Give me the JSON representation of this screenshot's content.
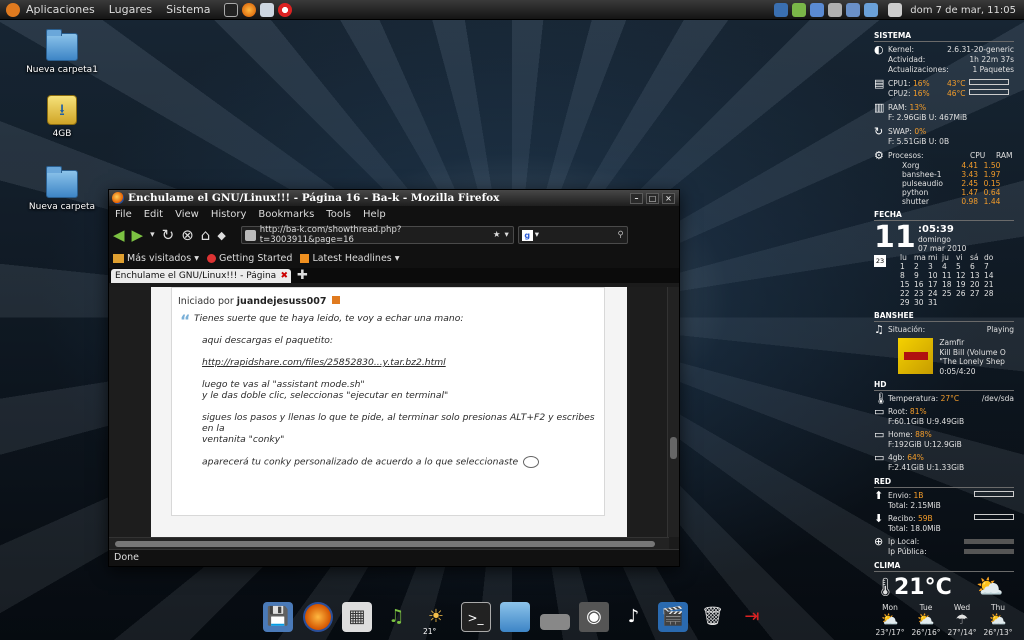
{
  "top_panel": {
    "menus": [
      "Aplicaciones",
      "Lugares",
      "Sistema"
    ],
    "clock": "dom 7 de mar, 11:05"
  },
  "desktop": {
    "icons": [
      {
        "label": "Nueva carpeta1",
        "icon": "folder-icon"
      },
      {
        "label": "4GB",
        "icon": "usb-drive-icon"
      },
      {
        "label": "Nueva carpeta",
        "icon": "folder-icon"
      }
    ]
  },
  "conky": {
    "sistema": {
      "title": "SISTEMA",
      "kernel_label": "Kernel:",
      "kernel": "2.6.31-20-generic",
      "actividad_label": "Actividad:",
      "actividad": "1h 22m 37s",
      "actualizaciones_label": "Actualizaciones:",
      "actualizaciones": "1 Paquetes",
      "cpu1_label": "CPU1:",
      "cpu1": "16%",
      "cpu1_temp": "43°C",
      "cpu2_label": "CPU2:",
      "cpu2": "16%",
      "cpu2_temp": "46°C",
      "ram_label": "RAM:",
      "ram": "13%",
      "ram_detail": "F: 2.96GiB U: 467MiB",
      "swap_label": "SWAP:",
      "swap": "0%",
      "swap_detail": "F: 5.51GiB U: 0B",
      "procesos_label": "Procesos:",
      "cpu_col": "CPU",
      "ram_col": "RAM",
      "procesos": [
        {
          "name": "Xorg",
          "cpu": "4.41",
          "ram": "1.50"
        },
        {
          "name": "banshee-1",
          "cpu": "3.43",
          "ram": "1.97"
        },
        {
          "name": "pulseaudio",
          "cpu": "2.45",
          "ram": "0.15"
        },
        {
          "name": "python",
          "cpu": "1.47",
          "ram": "0.64"
        },
        {
          "name": "shutter",
          "cpu": "0.98",
          "ram": "1.44"
        }
      ]
    },
    "fecha": {
      "title": "FECHA",
      "day": "11",
      "time": ":05:39",
      "weekday": "domingo",
      "date": "07 mar 2010",
      "cal_icon_day": "23",
      "weekdays": [
        "lu",
        "ma",
        "mi",
        "ju",
        "vi",
        "sá",
        "do"
      ],
      "weeks": [
        [
          "1",
          "2",
          "3",
          "4",
          "5",
          "6",
          "7"
        ],
        [
          "8",
          "9",
          "10",
          "11",
          "12",
          "13",
          "14"
        ],
        [
          "15",
          "16",
          "17",
          "18",
          "19",
          "20",
          "21"
        ],
        [
          "22",
          "23",
          "24",
          "25",
          "26",
          "27",
          "28"
        ],
        [
          "29",
          "30",
          "31",
          "",
          "",
          "",
          ""
        ]
      ],
      "calendar_first_row_offset": "     "
    },
    "banshee": {
      "title": "BANSHEE",
      "situacion_label": "Situación:",
      "situacion": "Playing",
      "artist": "Zamfir",
      "album": "Kill Bill (Volume O",
      "track": "\"The Lonely Shep",
      "progress": "0:05/4:20"
    },
    "hd": {
      "title": "HD",
      "temp_label": "Temperatura:",
      "temp": "27°C",
      "device": "/dev/sda",
      "root_label": "Root:",
      "root": "81%",
      "root_detail": "F:60.1GiB U:9.49GiB",
      "home_label": "Home:",
      "home": "88%",
      "home_detail": "F:192GiB U:12.9GiB",
      "g4_label": "4gb:",
      "g4": "64%",
      "g4_detail": "F:2.41GiB U:1.33GiB"
    },
    "red": {
      "title": "RED",
      "envio_label": "Envio:",
      "envio": "1B",
      "envio_total": "Total: 2.15MiB",
      "recibo_label": "Recibo:",
      "recibo": "59B",
      "recibo_total": "Total: 18.0MiB",
      "ip_local_label": "Ip Local:",
      "ip_publica_label": "Ip Pública:"
    },
    "clima": {
      "title": "CLIMA",
      "temp": "21°C",
      "forecast": [
        {
          "day": "Mon",
          "temp": "23°/17°"
        },
        {
          "day": "Tue",
          "temp": "26°/16°"
        },
        {
          "day": "Wed",
          "temp": "27°/14°"
        },
        {
          "day": "Thu",
          "temp": "26°/13°"
        }
      ]
    }
  },
  "firefox": {
    "title": "Enchulame el GNU/Linux!!! - Página 16 - Ba-k - Mozilla Firefox",
    "menus": [
      "File",
      "Edit",
      "View",
      "History",
      "Bookmarks",
      "Tools",
      "Help"
    ],
    "url": "http://ba-k.com/showthread.php?t=3003911&page=16",
    "bookmarks": [
      "Más visitados",
      "Getting Started",
      "Latest Headlines"
    ],
    "tab_label": "Enchulame el GNU/Linux!!! - Página ...",
    "status": "Done",
    "post": {
      "started_by": "Iniciado por",
      "author": "juandejesuss007",
      "lines": [
        "Tienes suerte que te haya leido, te voy a echar una mano:",
        "",
        "aqui descargas el paquetito:",
        "",
        "http://rapidshare.com/files/25852830...y.tar.bz2.html",
        "",
        "luego te vas al \"assistant mode.sh\"",
        "y le das doble clic, seleccionas \"ejecutar en terminal\"",
        "",
        "sigues los pasos y llenas lo que te pide, al terminar solo presionas ALT+F2 y escribes en la",
        "ventanita \"conky\"",
        "",
        "aparecerá tu conky personalizado de acuerdo a lo que seleccionaste"
      ]
    }
  },
  "dock": {
    "weather_temp": "21°"
  }
}
